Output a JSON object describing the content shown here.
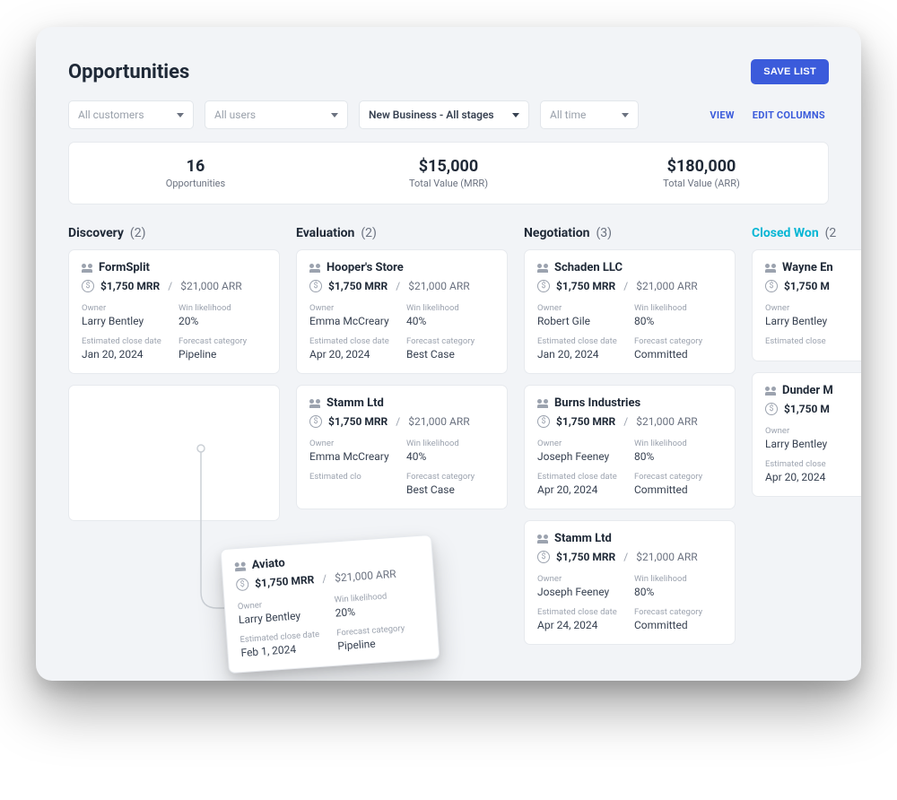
{
  "header": {
    "title": "Opportunities",
    "save_button": "SAVE LIST"
  },
  "filters": {
    "customers": "All customers",
    "users": "All users",
    "pipeline": "New Business - All stages",
    "time": "All time",
    "view": "VIEW",
    "edit_columns": "EDIT COLUMNS"
  },
  "summary": {
    "count_value": "16",
    "count_label": "Opportunities",
    "mrr_value": "$15,000",
    "mrr_label": "Total Value (MRR)",
    "arr_value": "$180,000",
    "arr_label": "Total Value (ARR)"
  },
  "labels": {
    "owner": "Owner",
    "win": "Win likelihood",
    "close": "Estimated close date",
    "forecast": "Forecast category"
  },
  "columns": {
    "discovery": {
      "title": "Discovery",
      "count": "(2)"
    },
    "evaluation": {
      "title": "Evaluation",
      "count": "(2)"
    },
    "negotiation": {
      "title": "Negotiation",
      "count": "(3)"
    },
    "closed_won": {
      "title": "Closed Won",
      "count": "(2"
    }
  },
  "cards": {
    "d1": {
      "company": "FormSplit",
      "mrr": "$1,750 MRR",
      "arr": "$21,000 ARR",
      "owner": "Larry Bentley",
      "win": "20%",
      "close": "Jan 20, 2024",
      "forecast": "Pipeline"
    },
    "e1": {
      "company": "Hooper's Store",
      "mrr": "$1,750 MRR",
      "arr": "$21,000 ARR",
      "owner": "Emma McCreary",
      "win": "40%",
      "close": "Apr 20, 2024",
      "forecast": "Best Case"
    },
    "e2": {
      "company": "Stamm Ltd",
      "mrr": "$1,750 MRR",
      "arr": "$21,000 ARR",
      "owner": "Emma McCreary",
      "win": "40%",
      "close": "",
      "forecast": "Best Case",
      "close_lbl": "Estimated clo"
    },
    "n1": {
      "company": "Schaden LLC",
      "mrr": "$1,750 MRR",
      "arr": "$21,000 ARR",
      "owner": "Robert Gile",
      "win": "80%",
      "close": "Jan 20, 2024",
      "forecast": "Committed"
    },
    "n2": {
      "company": "Burns Industries",
      "mrr": "$1,750 MRR",
      "arr": "$21,000 ARR",
      "owner": "Joseph Feeney",
      "win": "80%",
      "close": "Apr 20, 2024",
      "forecast": "Committed"
    },
    "n3": {
      "company": "Stamm Ltd",
      "mrr": "$1,750 MRR",
      "arr": "$21,000 ARR",
      "owner": "Joseph Feeney",
      "win": "80%",
      "close": "Apr 24, 2024",
      "forecast": "Committed"
    },
    "c1": {
      "company": "Wayne En",
      "mrr": "$1,750 M",
      "owner": "Larry Bentley",
      "close_lbl": "Estimated close"
    },
    "c2": {
      "company": "Dunder M",
      "mrr": "$1,750 M",
      "owner": "Larry Bentley",
      "close": "Apr 20, 2024",
      "close_lbl": "Estimated close"
    },
    "floating": {
      "company": "Aviato",
      "mrr": "$1,750 MRR",
      "arr": "$21,000 ARR",
      "owner": "Larry Bentley",
      "win": "20%",
      "close": "Feb 1, 2024",
      "forecast": "Pipeline"
    }
  }
}
